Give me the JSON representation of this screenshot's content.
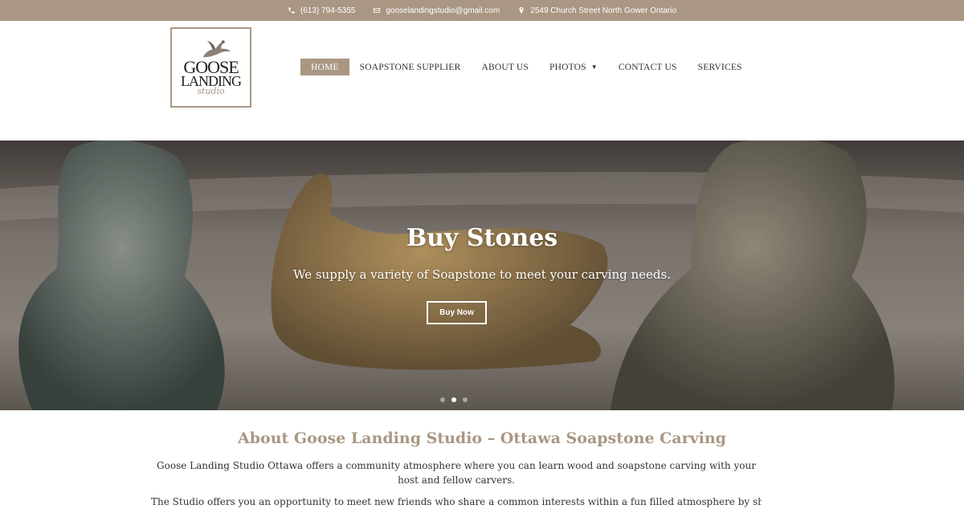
{
  "topbar": {
    "phone": "(613) 794-5355",
    "email": "gooselandingstudio@gmail.com",
    "address": "2549 Church Street North Gower Ontario"
  },
  "logo": {
    "line1": "GOOSE",
    "line2": "LANDING",
    "line3": "studio"
  },
  "nav": {
    "items": [
      {
        "label": "HOME"
      },
      {
        "label": "SOAPSTONE SUPPLIER"
      },
      {
        "label": "ABOUT US"
      },
      {
        "label": "PHOTOS"
      },
      {
        "label": "CONTACT US"
      },
      {
        "label": "SERVICES"
      }
    ]
  },
  "hero": {
    "title": "Buy Stones",
    "subtitle": "We supply a variety of Soapstone to meet your carving needs.",
    "button": "Buy Now",
    "slide_count": 3,
    "active_slide": 2
  },
  "about": {
    "title": "About Goose Landing Studio – Ottawa Soapstone Carving",
    "paragraph1": "Goose Landing Studio Ottawa offers a community atmosphere where you can learn wood and soapstone carving with your host and fellow carvers.",
    "paragraph2": "The Studio offers you an opportunity to meet new friends who share a common interests within a fun filled atmosphere by sharing"
  },
  "colors": {
    "accent": "#a99783",
    "text": "#333333"
  },
  "icons": {
    "phone": "phone-icon",
    "email": "envelope-icon",
    "address": "map-pin-icon",
    "photos_dropdown": "caret-down-icon"
  }
}
